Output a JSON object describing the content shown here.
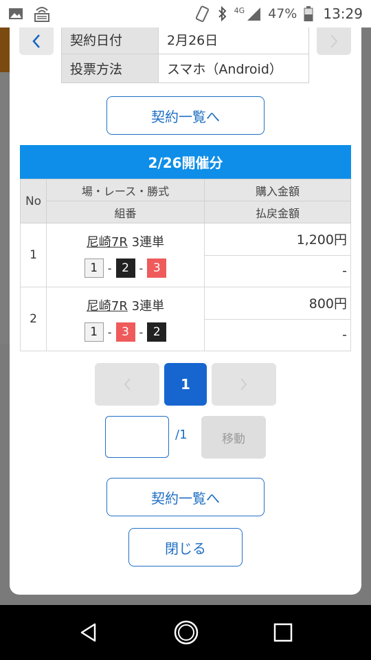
{
  "status_bar": {
    "battery": "47%",
    "time": "13:29",
    "network": "4G"
  },
  "contract": [
    {
      "label": "契約日付",
      "value": "2月26日"
    },
    {
      "label": "投票方法",
      "value": "スマホ（Android）"
    }
  ],
  "buttons": {
    "contract_list": "契約一覧へ",
    "close": "閉じる",
    "move": "移動"
  },
  "section_title": "2/26開催分",
  "table": {
    "header_no": "No",
    "header_race": "場・レース・勝式",
    "header_combo": "組番",
    "header_purchase": "購入金額",
    "header_refund": "払戻金額",
    "rows": [
      {
        "no": "1",
        "venue_race": "尼崎7R",
        "bet_type": "3連単",
        "combo": [
          "1",
          "2",
          "3"
        ],
        "purchase": "1,200円",
        "refund": "-"
      },
      {
        "no": "2",
        "venue_race": "尼崎7R",
        "bet_type": "3連単",
        "combo": [
          "1",
          "3",
          "2"
        ],
        "purchase": "800円",
        "refund": "-"
      }
    ]
  },
  "pagination": {
    "current": "1",
    "total": "/1",
    "separator": "-"
  },
  "colors": {
    "accent": "#1766d0",
    "section_bg": "#0e8ee8",
    "boat_1": "#f2f2f2",
    "boat_2": "#222222",
    "boat_3": "#ef5b5b"
  }
}
